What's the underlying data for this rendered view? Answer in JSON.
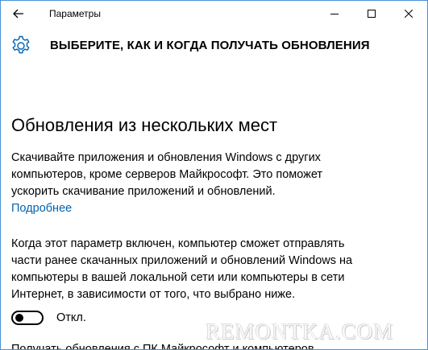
{
  "window": {
    "app_title": "Параметры"
  },
  "header": {
    "title": "ВЫБЕРИТЕ, КАК И КОГДА ПОЛУЧАТЬ ОБНОВЛЕНИЯ"
  },
  "main": {
    "section_title": "Обновления из нескольких мест",
    "paragraph1_lines": [
      "Скачивайте приложения и обновления Windows с других",
      "компьютеров, кроме серверов Майкрософт. Это поможет",
      "ускорить скачивание приложений и обновлений."
    ],
    "learn_more_link": "Подробнее",
    "paragraph2_lines": [
      "Когда этот параметр включен, компьютер сможет отправлять",
      "части ранее скачанных приложений и обновлений Windows на",
      "компьютеры в вашей локальной сети или компьютеры в сети",
      "Интернет, в зависимости от того, что выбрано ниже."
    ],
    "toggle": {
      "state": "off",
      "label": "Откл."
    },
    "cut_off_text": "Получать обновления с ПК Майкрософт и компьютеров"
  },
  "watermark": "REMONTKA.COM",
  "colors": {
    "accent_link": "#0063b1",
    "window_border": "#4a8fd6",
    "gear": "#0063b1"
  },
  "icons": {
    "back": "back-arrow-icon",
    "minimize": "minimize-icon",
    "maximize": "maximize-icon",
    "close": "close-icon",
    "settings": "gear-icon"
  }
}
